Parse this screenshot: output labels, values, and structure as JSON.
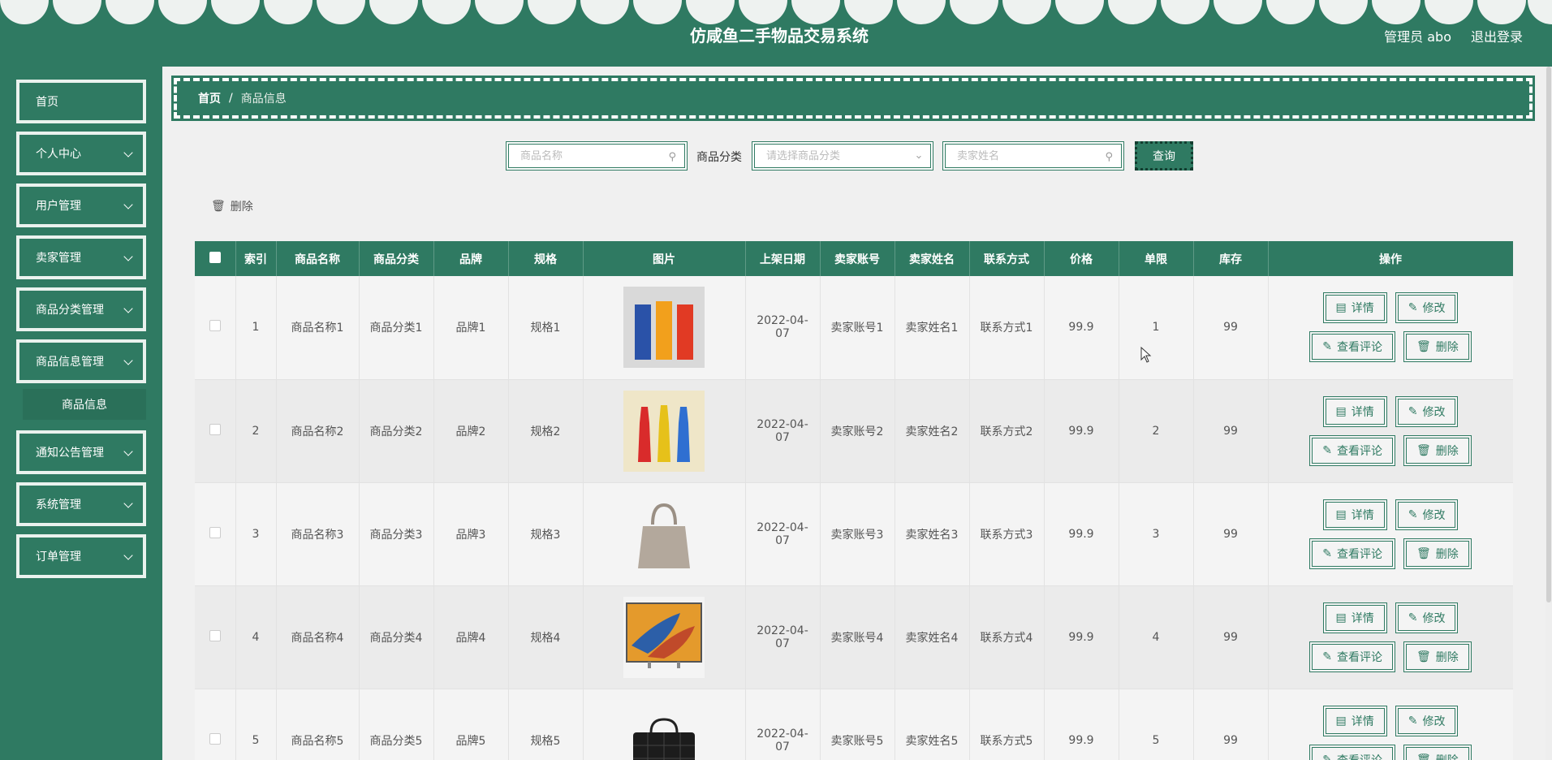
{
  "header": {
    "title": "仿咸鱼二手物品交易系统",
    "user": "管理员 abo",
    "logout": "退出登录"
  },
  "sidebar": {
    "items": [
      {
        "label": "首页",
        "expandable": false
      },
      {
        "label": "个人中心",
        "expandable": true
      },
      {
        "label": "用户管理",
        "expandable": true
      },
      {
        "label": "卖家管理",
        "expandable": true
      },
      {
        "label": "商品分类管理",
        "expandable": true
      },
      {
        "label": "商品信息管理",
        "expandable": true
      },
      {
        "label": "商品信息",
        "sub": true
      },
      {
        "label": "通知公告管理",
        "expandable": true
      },
      {
        "label": "系统管理",
        "expandable": true
      },
      {
        "label": "订单管理",
        "expandable": true
      }
    ]
  },
  "breadcrumb": {
    "home": "首页",
    "sep": "/",
    "current": "商品信息"
  },
  "search": {
    "name_placeholder": "商品名称",
    "category_label": "商品分类",
    "category_placeholder": "请选择商品分类",
    "seller_placeholder": "卖家姓名",
    "query": "查询"
  },
  "toolbar": {
    "delete": "删除"
  },
  "table": {
    "headers": [
      "索引",
      "商品名称",
      "商品分类",
      "品牌",
      "规格",
      "图片",
      "上架日期",
      "卖家账号",
      "卖家姓名",
      "联系方式",
      "价格",
      "单限",
      "库存",
      "操作"
    ],
    "rows": [
      {
        "idx": "1",
        "name": "商品名称1",
        "category": "商品分类1",
        "brand": "品牌1",
        "spec": "规格1",
        "date": "2022-04-07",
        "account": "卖家账号1",
        "seller": "卖家姓名1",
        "contact": "联系方式1",
        "price": "99.9",
        "limit": "1",
        "stock": "99"
      },
      {
        "idx": "2",
        "name": "商品名称2",
        "category": "商品分类2",
        "brand": "品牌2",
        "spec": "规格2",
        "date": "2022-04-07",
        "account": "卖家账号2",
        "seller": "卖家姓名2",
        "contact": "联系方式2",
        "price": "99.9",
        "limit": "2",
        "stock": "99"
      },
      {
        "idx": "3",
        "name": "商品名称3",
        "category": "商品分类3",
        "brand": "品牌3",
        "spec": "规格3",
        "date": "2022-04-07",
        "account": "卖家账号3",
        "seller": "卖家姓名3",
        "contact": "联系方式3",
        "price": "99.9",
        "limit": "3",
        "stock": "99"
      },
      {
        "idx": "4",
        "name": "商品名称4",
        "category": "商品分类4",
        "brand": "品牌4",
        "spec": "规格4",
        "date": "2022-04-07",
        "account": "卖家账号4",
        "seller": "卖家姓名4",
        "contact": "联系方式4",
        "price": "99.9",
        "limit": "4",
        "stock": "99"
      },
      {
        "idx": "5",
        "name": "商品名称5",
        "category": "商品分类5",
        "brand": "品牌5",
        "spec": "规格5",
        "date": "2022-04-07",
        "account": "卖家账号5",
        "seller": "卖家姓名5",
        "contact": "联系方式5",
        "price": "99.9",
        "limit": "5",
        "stock": "99"
      }
    ],
    "actions": {
      "detail": "详情",
      "edit": "修改",
      "reviews": "查看评论",
      "delete": "删除"
    }
  },
  "colors": {
    "primary": "#2f7a62",
    "header_text": "#ffffff"
  }
}
